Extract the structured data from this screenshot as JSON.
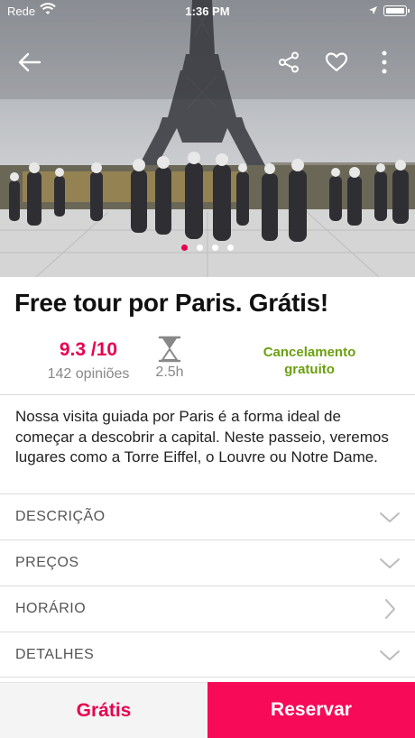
{
  "status_bar": {
    "carrier": "Rede",
    "time": "1:36 PM"
  },
  "nav": {
    "icons": [
      "arrow-left-icon",
      "share-icon",
      "heart-icon",
      "more-vertical-icon"
    ]
  },
  "gallery": {
    "total_images": 4,
    "active_index": 0
  },
  "tour": {
    "title": "Free tour por Paris. Grátis!",
    "rating": "9.3 /10",
    "reviews": "142 opiniões",
    "duration": "2.5h",
    "cancellation": "Cancelamento gratuito",
    "description": "Nossa visita guiada por Paris é a forma ideal de começar a descobrir a capital. Neste passeio, veremos lugares como a Torre Eiffel, o Louvre ou Notre Dame."
  },
  "sections": [
    {
      "label": "DESCRIÇÃO",
      "icon": "chevron-down-icon"
    },
    {
      "label": "PREÇOS",
      "icon": "chevron-down-icon"
    },
    {
      "label": "HORÁRIO",
      "icon": "chevron-right-icon"
    },
    {
      "label": "DETALHES",
      "icon": "chevron-down-icon"
    }
  ],
  "footer": {
    "price_label": "Grátis",
    "book_label": "Reservar"
  },
  "colors": {
    "accent": "#e8004e",
    "book_button": "#f70a58",
    "cancellation_green": "#6ba010",
    "muted_text": "#888888"
  }
}
